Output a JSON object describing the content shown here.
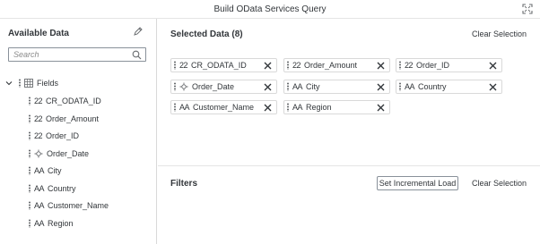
{
  "window": {
    "title": "Build OData Services Query"
  },
  "left_panel": {
    "title": "Available Data",
    "search_placeholder": "Search",
    "tree": {
      "root_label": "Fields",
      "items": [
        {
          "glyph": "22",
          "label": "CR_ODATA_ID",
          "type": "number"
        },
        {
          "glyph": "22",
          "label": "Order_Amount",
          "type": "number"
        },
        {
          "glyph": "22",
          "label": "Order_ID",
          "type": "number"
        },
        {
          "glyph": "",
          "label": "Order_Date",
          "type": "time"
        },
        {
          "glyph": "AA",
          "label": "City",
          "type": "text"
        },
        {
          "glyph": "AA",
          "label": "Country",
          "type": "text"
        },
        {
          "glyph": "AA",
          "label": "Customer_Name",
          "type": "text"
        },
        {
          "glyph": "AA",
          "label": "Region",
          "type": "text"
        }
      ]
    }
  },
  "selected": {
    "title": "Selected Data (8)",
    "clear_label": "Clear Selection",
    "chips": [
      {
        "glyph": "22",
        "label": "CR_ODATA_ID",
        "type": "number"
      },
      {
        "glyph": "22",
        "label": "Order_Amount",
        "type": "number"
      },
      {
        "glyph": "22",
        "label": "Order_ID",
        "type": "number"
      },
      {
        "glyph": "",
        "label": "Order_Date",
        "type": "time"
      },
      {
        "glyph": "AA",
        "label": "City",
        "type": "text"
      },
      {
        "glyph": "AA",
        "label": "Country",
        "type": "text"
      },
      {
        "glyph": "AA",
        "label": "Customer_Name",
        "type": "text"
      },
      {
        "glyph": "AA",
        "label": "Region",
        "type": "text"
      }
    ]
  },
  "filters": {
    "title": "Filters",
    "incremental_label": "Set Incremental Load",
    "clear_label": "Clear Selection"
  },
  "icons": {
    "expand": "expand-icon",
    "edit": "pencil-icon",
    "search": "search-icon",
    "caret": "chevron-down-icon",
    "table": "grid-icon",
    "time": "time-dimension-icon",
    "close": "close-icon"
  }
}
